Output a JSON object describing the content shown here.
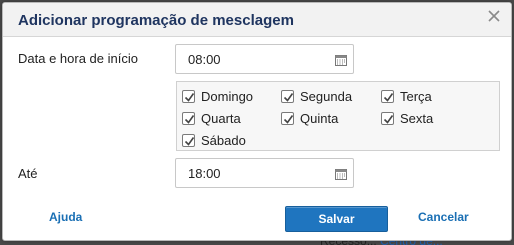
{
  "background": {
    "text": "Recesso...",
    "link": "Centro de..."
  },
  "dialog": {
    "title": "Adicionar programação de mesclagem",
    "start_label": "Data e hora de início",
    "start_time": "08:00",
    "until_label": "Até",
    "end_time": "18:00",
    "days": [
      {
        "label": "Domingo",
        "checked": true
      },
      {
        "label": "Segunda",
        "checked": true
      },
      {
        "label": "Terça",
        "checked": true
      },
      {
        "label": "Quarta",
        "checked": true
      },
      {
        "label": "Quinta",
        "checked": true
      },
      {
        "label": "Sexta",
        "checked": true
      },
      {
        "label": "Sábado",
        "checked": true
      }
    ],
    "help_label": "Ajuda",
    "save_label": "Salvar",
    "cancel_label": "Cancelar"
  },
  "icons": {
    "close": "close-icon",
    "calendar": "calendar-icon",
    "checkbox": "checkmark-icon"
  },
  "colors": {
    "title": "#1f3560",
    "accent": "#1f75bf",
    "link": "#1a6fb4"
  }
}
